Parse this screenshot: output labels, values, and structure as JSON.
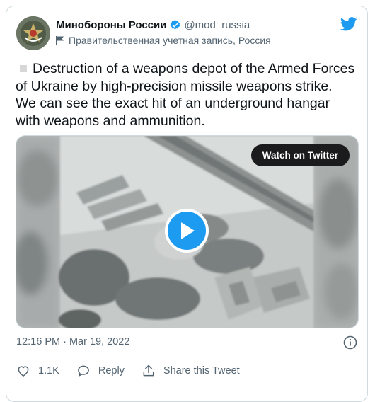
{
  "author": {
    "name": "Минобороны России",
    "handle": "@mod_russia",
    "label": "Правительственная учетная запись, Россия"
  },
  "tweet": {
    "text": "Destruction of a weapons depot of the Armed Forces of Ukraine by high-precision missile weapons strike. We can see the exact hit of an underground hangar with weapons and ammunition.",
    "timestamp": "12:16 PM · Mar 19, 2022"
  },
  "media": {
    "watch_label": "Watch on Twitter"
  },
  "actions": {
    "likes": "1.1K",
    "reply_label": "Reply",
    "share_label": "Share this Tweet"
  },
  "colors": {
    "accent": "#1d9bf0",
    "secondary_text": "#536471"
  },
  "icons": [
    "verified-badge-icon",
    "flag-icon",
    "twitter-bird-icon",
    "play-icon",
    "info-icon",
    "heart-icon",
    "reply-icon",
    "share-icon"
  ]
}
